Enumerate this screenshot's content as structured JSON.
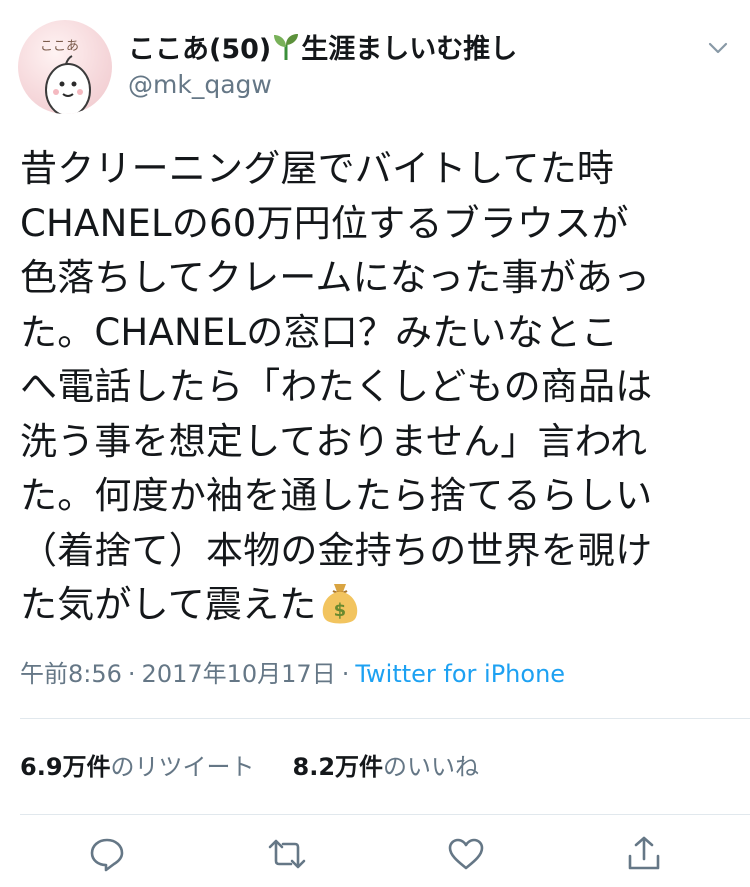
{
  "user": {
    "display_name": "ここあ(50)",
    "display_name_suffix": "生涯ましいむ推し",
    "handle": "@mk_qagw",
    "avatar_text": "ここあ"
  },
  "tweet": {
    "lines": [
      "昔クリーニング屋でバイトしてた時",
      "CHANELの60万円位するブラウスが",
      "色落ちしてクレームになった事があっ",
      "た。CHANELの窓口？みたいなとこ",
      "へ電話したら「わたくしどもの商品は",
      "洗う事を想定しておりません」言われ",
      "た。何度か袖を通したら捨てるらしい",
      "（着捨て）本物の金持ちの世界を覗け",
      "た気がして震えた"
    ]
  },
  "meta": {
    "time": "午前8:56",
    "separator": "·",
    "date": "2017年10月17日",
    "source": "Twitter for iPhone"
  },
  "stats": {
    "retweets": {
      "count": "6.9万件",
      "label": "のリツイート"
    },
    "likes": {
      "count": "8.2万件",
      "label": "のいいね"
    }
  },
  "colors": {
    "text": "#14171a",
    "secondary": "#657786",
    "link": "#1da1f2",
    "divider": "#e1e8ed"
  },
  "icons": {
    "sprout": "seedling-icon",
    "moneybag": "money-bag-icon",
    "chevron": "chevron-down-icon",
    "reply": "reply-icon",
    "retweet": "retweet-icon",
    "like": "heart-icon",
    "share": "share-icon"
  }
}
